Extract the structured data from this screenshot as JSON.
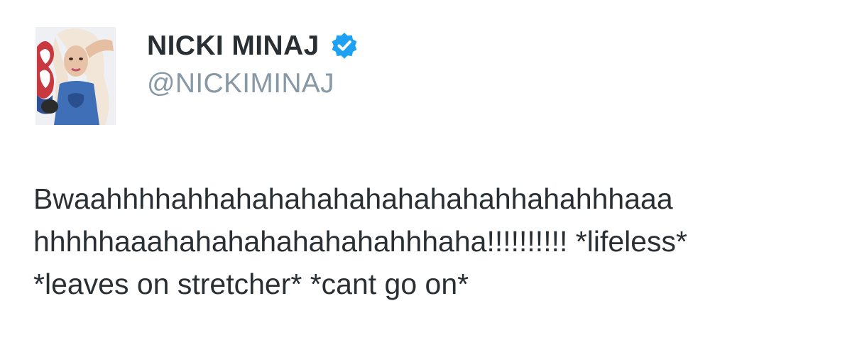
{
  "tweet": {
    "author": {
      "display_name": "NICKI MINAJ",
      "handle": "@NICKIMINAJ",
      "verified": true,
      "avatar_icon": "profile-photo",
      "verified_icon": "verified-badge-icon"
    },
    "text_lines": [
      "Bwaahhhhahhahahahahahahahahahhahahhhaaa",
      "hhhhhaaahahahahahahahahhhaha!!!!!!!!!! *lifeless*",
      "*leaves on stretcher* *cant go on*"
    ]
  },
  "colors": {
    "text": "#292f33",
    "handle": "#8899a6",
    "verified_blue": "#1da1f2",
    "background": "#ffffff"
  }
}
